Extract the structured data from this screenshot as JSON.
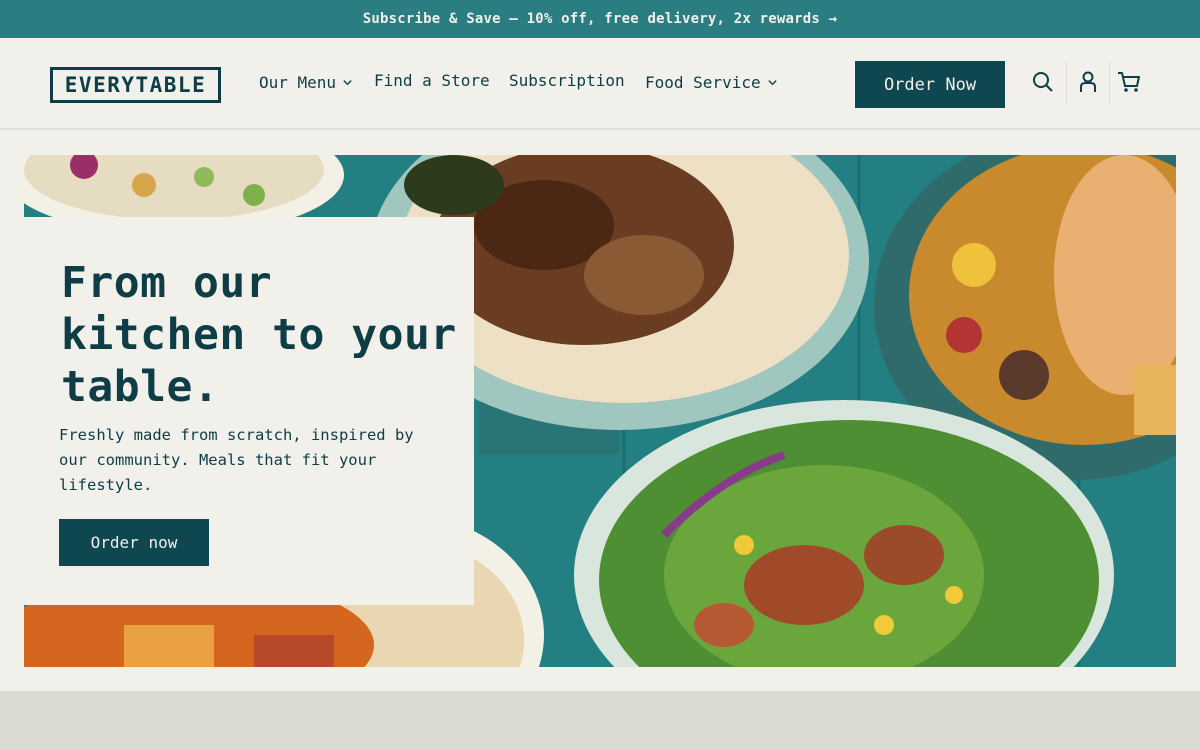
{
  "promo": {
    "text": "Subscribe & Save — 10% off, free delivery, 2x rewards →"
  },
  "header": {
    "logo": "EVERYTABLE",
    "nav": {
      "menu": "Our Menu",
      "find_store": "Find a Store",
      "subscription": "Subscription",
      "food_service": "Food Service"
    },
    "order_label": "Order Now",
    "icons": [
      "search-icon",
      "account-icon",
      "cart-icon"
    ]
  },
  "hero": {
    "headline": "From our kitchen to your table.",
    "body": "Freshly made from scratch, inspired by our community. Meals that fit your lifestyle.",
    "cta": "Order now"
  },
  "colors": {
    "brand_dark": "#0e3d45",
    "promo_teal": "#2a7d80",
    "background": "#f1f0ea",
    "button": "#0e4750"
  }
}
